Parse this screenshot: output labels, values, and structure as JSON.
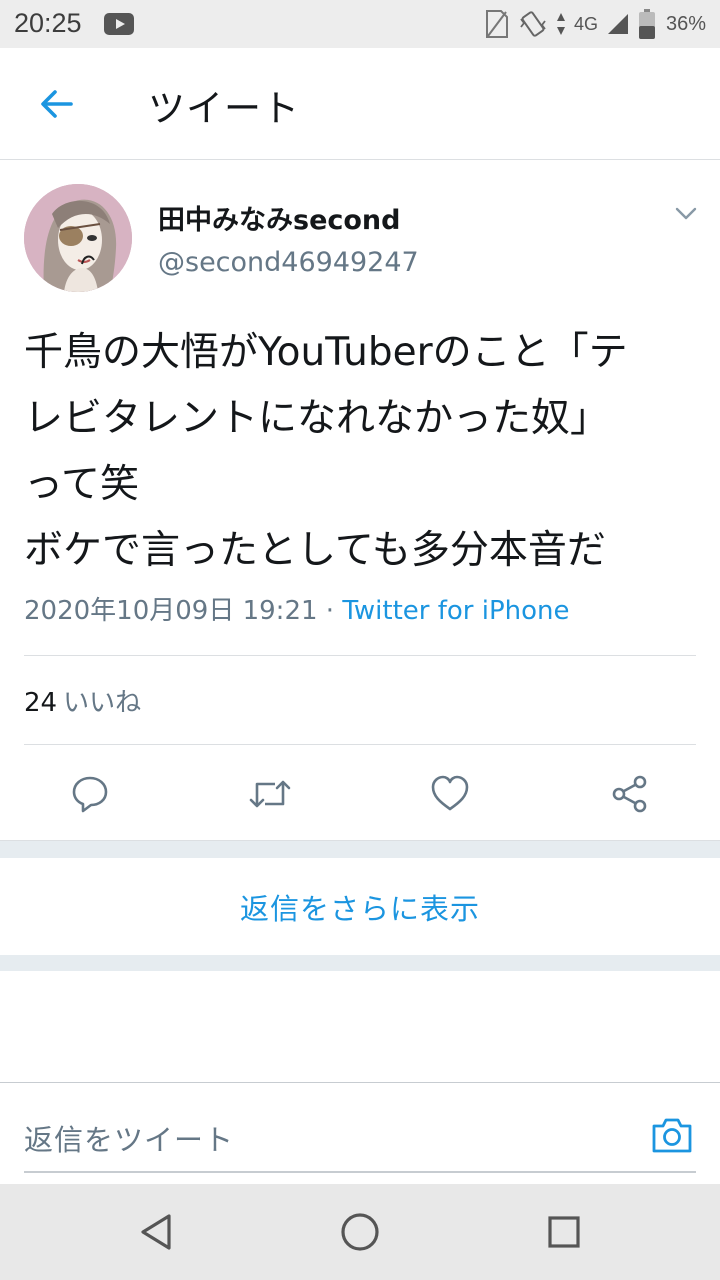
{
  "status_bar": {
    "time": "20:25",
    "network": "4G",
    "battery": "36%"
  },
  "header": {
    "title": "ツイート"
  },
  "tweet": {
    "author_name": "田中みなみsecond",
    "author_handle": "@second46949247",
    "text_lines": [
      "千鳥の大悟がYouTuberのこと「テ",
      "レビタレントになれなかった奴」",
      "って笑",
      "ボケで言ったとしても多分本音だ"
    ],
    "timestamp": "2020年10月09日 19:21",
    "separator": " · ",
    "source": "Twitter for iPhone",
    "likes_count": "24",
    "likes_label": "いいね"
  },
  "replies": {
    "show_more_label": "返信をさらに表示"
  },
  "reply_bar": {
    "placeholder": "返信をツイート"
  },
  "colors": {
    "accent": "#1b95e0",
    "secondary_text": "#657786",
    "divider": "#dcdfe2"
  },
  "icons": {
    "back": "back-arrow-icon",
    "caret": "chevron-down-icon",
    "reply": "reply-icon",
    "retweet": "retweet-icon",
    "like": "heart-icon",
    "share": "share-icon",
    "camera": "camera-icon"
  }
}
